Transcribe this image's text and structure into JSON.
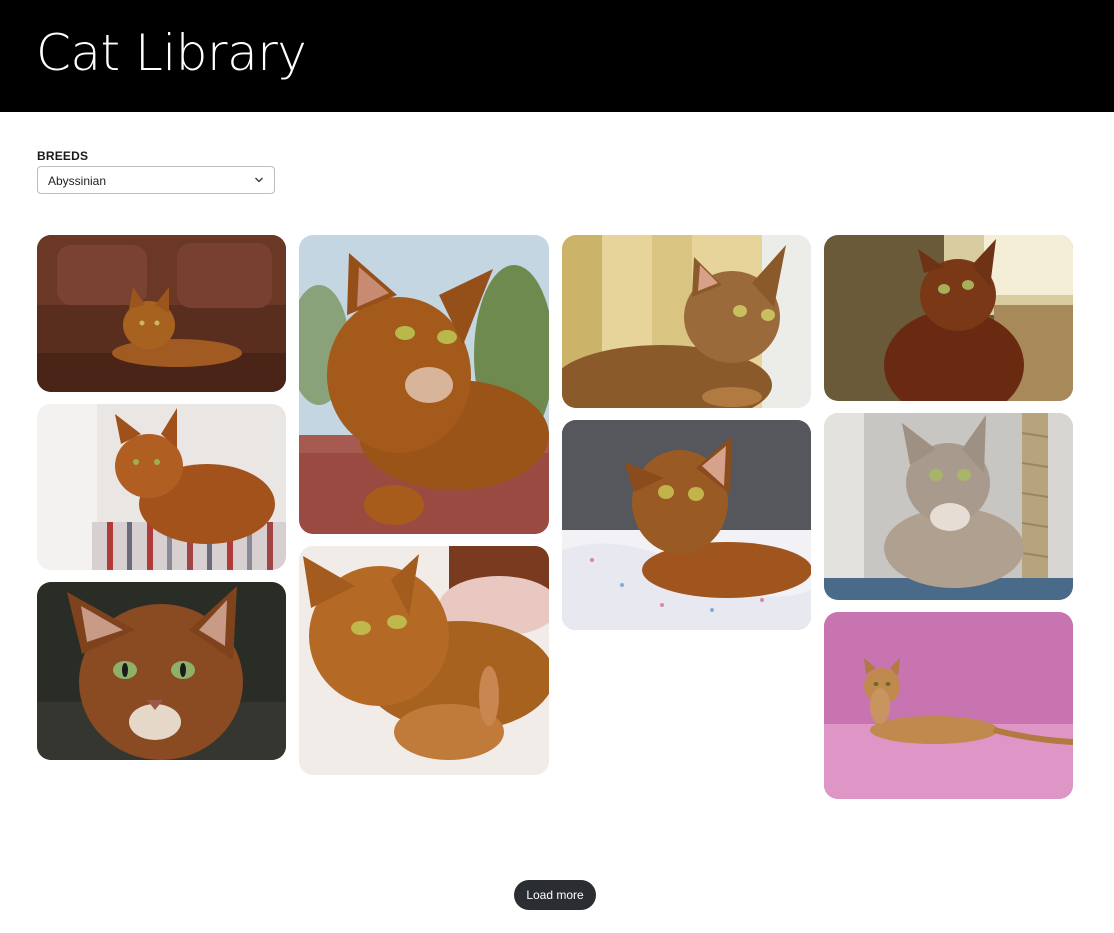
{
  "header": {
    "title": "Cat Library"
  },
  "filters": {
    "breeds_label": "BREEDS",
    "selected_breed": "Abyssinian"
  },
  "gallery": {
    "images": [
      {
        "name": "cat-photo-1",
        "subject": "ruddy Abyssinian lying on brown leather sofa"
      },
      {
        "name": "cat-photo-2",
        "subject": "ruddy Abyssinian on striped cushion"
      },
      {
        "name": "cat-photo-3",
        "subject": "close-up portrait of Abyssinian face"
      },
      {
        "name": "cat-photo-4",
        "subject": "Abyssinian resting on red brick ledge outdoors"
      },
      {
        "name": "cat-photo-5",
        "subject": "Abyssinian mother with kitten on white blanket"
      },
      {
        "name": "cat-photo-6",
        "subject": "Abyssinian lying in sunlight by window"
      },
      {
        "name": "cat-photo-7",
        "subject": "Abyssinian looking up on patterned bedding"
      },
      {
        "name": "cat-photo-8",
        "subject": "Abyssinian sitting, looking up, warm background"
      },
      {
        "name": "cat-photo-9",
        "subject": "fawn Abyssinian next to scratching post"
      },
      {
        "name": "cat-photo-10",
        "subject": "Abyssinian lying on pink backdrop"
      }
    ]
  },
  "actions": {
    "load_more_label": "Load more"
  },
  "colors": {
    "header_bg": "#000000",
    "button_bg": "#2a2d31"
  }
}
